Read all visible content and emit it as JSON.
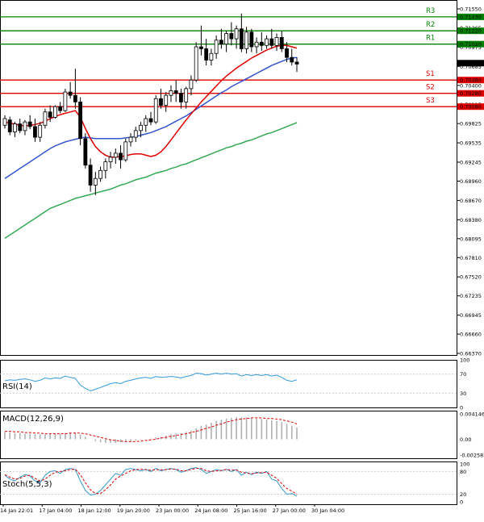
{
  "chart_data": {
    "type": "candlestick",
    "main": {
      "ylim": [
        0.6637,
        0.7155
      ],
      "y_ticks": [
        "0.71550",
        "0.71265",
        "0.70975",
        "0.70685",
        "0.70400",
        "0.70115",
        "0.69825",
        "0.69535",
        "0.69245",
        "0.68960",
        "0.68670",
        "0.68380",
        "0.68095",
        "0.67810",
        "0.67520",
        "0.67235",
        "0.66945",
        "0.66660",
        "0.66370"
      ],
      "current_price": "0.70734",
      "candles": [
        [
          0.698,
          0.6995,
          0.6975,
          0.699
        ],
        [
          0.6988,
          0.6993,
          0.6965,
          0.697
        ],
        [
          0.697,
          0.6985,
          0.6962,
          0.6982
        ],
        [
          0.6982,
          0.699,
          0.6968,
          0.6972
        ],
        [
          0.6972,
          0.6988,
          0.6965,
          0.6985
        ],
        [
          0.6985,
          0.6995,
          0.6974,
          0.6978
        ],
        [
          0.6978,
          0.699,
          0.6955,
          0.6962
        ],
        [
          0.6962,
          0.6985,
          0.6955,
          0.698
        ],
        [
          0.698,
          0.7005,
          0.6975,
          0.7
        ],
        [
          0.7,
          0.701,
          0.6985,
          0.6992
        ],
        [
          0.6992,
          0.701,
          0.699,
          0.7008
        ],
        [
          0.7008,
          0.7015,
          0.6998,
          0.7002
        ],
        [
          0.7002,
          0.7035,
          0.7,
          0.703
        ],
        [
          0.703,
          0.7045,
          0.702,
          0.7025
        ],
        [
          0.7025,
          0.7065,
          0.7005,
          0.7015
        ],
        [
          0.7015,
          0.7022,
          0.695,
          0.696
        ],
        [
          0.696,
          0.6968,
          0.6915,
          0.692
        ],
        [
          0.692,
          0.693,
          0.688,
          0.689
        ],
        [
          0.689,
          0.691,
          0.6875,
          0.69
        ],
        [
          0.69,
          0.6918,
          0.6895,
          0.6912
        ],
        [
          0.6912,
          0.693,
          0.69,
          0.6925
        ],
        [
          0.6925,
          0.694,
          0.6915,
          0.6932
        ],
        [
          0.6932,
          0.6945,
          0.6922,
          0.6938
        ],
        [
          0.6938,
          0.695,
          0.6915,
          0.6928
        ],
        [
          0.6928,
          0.696,
          0.6925,
          0.6955
        ],
        [
          0.6955,
          0.6968,
          0.6948,
          0.6962
        ],
        [
          0.6962,
          0.6978,
          0.6955,
          0.6972
        ],
        [
          0.6972,
          0.6985,
          0.6962,
          0.698
        ],
        [
          0.698,
          0.6995,
          0.697,
          0.699
        ],
        [
          0.699,
          0.7,
          0.698,
          0.6985
        ],
        [
          0.6985,
          0.7025,
          0.6982,
          0.702
        ],
        [
          0.702,
          0.7035,
          0.7005,
          0.701
        ],
        [
          0.701,
          0.703,
          0.7,
          0.7025
        ],
        [
          0.7025,
          0.704,
          0.7015,
          0.7032
        ],
        [
          0.7032,
          0.7048,
          0.7015,
          0.7028
        ],
        [
          0.7028,
          0.7035,
          0.7005,
          0.7015
        ],
        [
          0.7015,
          0.7038,
          0.7005,
          0.7035
        ],
        [
          0.7035,
          0.7055,
          0.7025,
          0.7048
        ],
        [
          0.7048,
          0.7105,
          0.7045,
          0.7098
        ],
        [
          0.7098,
          0.713,
          0.7085,
          0.7095
        ],
        [
          0.7095,
          0.711,
          0.707,
          0.7078
        ],
        [
          0.7078,
          0.7095,
          0.707,
          0.7088
        ],
        [
          0.7088,
          0.7115,
          0.708,
          0.7108
        ],
        [
          0.7108,
          0.7125,
          0.7095,
          0.7102
        ],
        [
          0.7102,
          0.7122,
          0.709,
          0.7118
        ],
        [
          0.7118,
          0.7135,
          0.71,
          0.711
        ],
        [
          0.711,
          0.713,
          0.7095,
          0.7125
        ],
        [
          0.7125,
          0.7148,
          0.709,
          0.7095
        ],
        [
          0.7095,
          0.7128,
          0.7088,
          0.712
        ],
        [
          0.712,
          0.7125,
          0.709,
          0.7098
        ],
        [
          0.7098,
          0.7112,
          0.7088,
          0.7105
        ],
        [
          0.7105,
          0.712,
          0.7092,
          0.71
        ],
        [
          0.71,
          0.7115,
          0.7095,
          0.711
        ],
        [
          0.711,
          0.7125,
          0.7095,
          0.71
        ],
        [
          0.71,
          0.7118,
          0.7092,
          0.7112
        ],
        [
          0.7112,
          0.7122,
          0.709,
          0.7095
        ],
        [
          0.7095,
          0.7105,
          0.7075,
          0.7082
        ],
        [
          0.7082,
          0.7095,
          0.707,
          0.7075
        ],
        [
          0.7075,
          0.7082,
          0.706,
          0.7072
        ]
      ],
      "ma_fast": [
        0.6985,
        0.6983,
        0.6982,
        0.698,
        0.6979,
        0.698,
        0.6981,
        0.6983,
        0.6986,
        0.699,
        0.6993,
        0.6996,
        0.6998,
        0.7,
        0.7002,
        0.6992,
        0.6975,
        0.696,
        0.6948,
        0.694,
        0.6935,
        0.6932,
        0.6932,
        0.6933,
        0.6934,
        0.6936,
        0.6937,
        0.6937,
        0.6935,
        0.6933,
        0.6935,
        0.694,
        0.6948,
        0.6958,
        0.6968,
        0.6978,
        0.6988,
        0.6997,
        0.7006,
        0.7015,
        0.7023,
        0.7031,
        0.7039,
        0.7047,
        0.7054,
        0.706,
        0.7066,
        0.7071,
        0.7076,
        0.7081,
        0.7085,
        0.7089,
        0.7093,
        0.7096,
        0.7099,
        0.71,
        0.71,
        0.7098,
        0.7096
      ],
      "ma_mid": [
        0.69,
        0.6905,
        0.691,
        0.6915,
        0.692,
        0.6925,
        0.693,
        0.6935,
        0.694,
        0.6945,
        0.6949,
        0.6952,
        0.6955,
        0.6957,
        0.6959,
        0.6961,
        0.6962,
        0.6961,
        0.696,
        0.696,
        0.696,
        0.696,
        0.696,
        0.696,
        0.6961,
        0.6962,
        0.6963,
        0.6965,
        0.6967,
        0.6969,
        0.6972,
        0.6975,
        0.6978,
        0.6982,
        0.6986,
        0.699,
        0.6994,
        0.6999,
        0.7004,
        0.7009,
        0.7014,
        0.7019,
        0.7024,
        0.7029,
        0.7033,
        0.7038,
        0.7042,
        0.7046,
        0.705,
        0.7054,
        0.7058,
        0.7062,
        0.7066,
        0.707,
        0.7073,
        0.7076,
        0.7079,
        0.7081,
        0.7082
      ],
      "ma_slow": [
        0.681,
        0.6815,
        0.682,
        0.6825,
        0.683,
        0.6835,
        0.684,
        0.6845,
        0.685,
        0.6855,
        0.6858,
        0.6861,
        0.6864,
        0.6867,
        0.687,
        0.6872,
        0.6874,
        0.6876,
        0.6878,
        0.688,
        0.6882,
        0.6884,
        0.6887,
        0.689,
        0.6892,
        0.6895,
        0.6898,
        0.69,
        0.6902,
        0.6905,
        0.6908,
        0.691,
        0.6912,
        0.6915,
        0.6917,
        0.692,
        0.6922,
        0.6925,
        0.6928,
        0.6931,
        0.6934,
        0.6937,
        0.694,
        0.6943,
        0.6946,
        0.6948,
        0.6951,
        0.6953,
        0.6956,
        0.6958,
        0.6961,
        0.6964,
        0.6967,
        0.6969,
        0.6972,
        0.6975,
        0.6978,
        0.6981,
        0.6984
      ],
      "levels": [
        {
          "label": "R3",
          "value": 0.7143,
          "value_text": "0.71430",
          "color": "#008000"
        },
        {
          "label": "R2",
          "value": 0.7122,
          "value_text": "0.71220",
          "color": "#008000"
        },
        {
          "label": "R1",
          "value": 0.7102,
          "value_text": "0.71020",
          "color": "#008000"
        },
        {
          "label": "S1",
          "value": 0.7048,
          "value_text": "0.70480",
          "color": "#e00000"
        },
        {
          "label": "S2",
          "value": 0.7028,
          "value_text": "0.70280",
          "color": "#e00000"
        },
        {
          "label": "S3",
          "value": 0.7008,
          "value_text": "0.70080",
          "color": "#e00000"
        }
      ]
    },
    "x_labels": [
      "14 Jan 22:01",
      "17 Jan 04:00",
      "18 Jan 12:00",
      "19 Jan 20:00",
      "23 Jan 00:00",
      "24 Jan 08:00",
      "25 Jan 16:00",
      "27 Jan 00:00",
      "30 Jan 04:00"
    ],
    "rsi": {
      "label": "RSI(14)",
      "ylim": [
        0,
        100
      ],
      "ticks": [
        "100",
        "70",
        "30",
        "0"
      ],
      "values": [
        56,
        58,
        57,
        59,
        60,
        58,
        55,
        57,
        62,
        60,
        62,
        61,
        66,
        63,
        61,
        47,
        40,
        35,
        38,
        42,
        46,
        50,
        52,
        50,
        55,
        57,
        60,
        62,
        63,
        61,
        65,
        63,
        64,
        65,
        64,
        62,
        65,
        67,
        72,
        71,
        68,
        70,
        72,
        70,
        72,
        70,
        71,
        66,
        69,
        67,
        69,
        67,
        69,
        66,
        68,
        63,
        57,
        55,
        58
      ]
    },
    "macd": {
      "label": "MACD(12,26,9)",
      "ticks": [
        "0.004146",
        "0.00",
        "-0.002585"
      ],
      "ylim": [
        -0.002585,
        0.004146
      ],
      "histogram": [
        0.0012,
        0.0011,
        0.001,
        0.001,
        0.0009,
        0.0009,
        0.0008,
        0.0008,
        0.0008,
        0.0009,
        0.0009,
        0.0009,
        0.001,
        0.0011,
        0.0011,
        0.0008,
        0.0004,
        0.0,
        -0.0003,
        -0.0005,
        -0.0006,
        -0.0006,
        -0.0006,
        -0.0005,
        -0.0004,
        -0.0003,
        -0.0002,
        -0.0001,
        0.0,
        0.0001,
        0.0003,
        0.0004,
        0.0006,
        0.0008,
        0.0009,
        0.001,
        0.0012,
        0.0014,
        0.0018,
        0.0022,
        0.0024,
        0.0027,
        0.003,
        0.0032,
        0.0034,
        0.0035,
        0.0036,
        0.0036,
        0.0036,
        0.0035,
        0.0034,
        0.0033,
        0.0032,
        0.0031,
        0.003,
        0.0028,
        0.0025,
        0.0022,
        0.0019
      ],
      "signal": [
        0.0013,
        0.0013,
        0.0012,
        0.0012,
        0.0011,
        0.0011,
        0.001,
        0.001,
        0.0009,
        0.0009,
        0.0009,
        0.0009,
        0.0009,
        0.001,
        0.001,
        0.001,
        0.0009,
        0.0007,
        0.0005,
        0.0003,
        0.0001,
        -0.0001,
        -0.0002,
        -0.0003,
        -0.0004,
        -0.0004,
        -0.0004,
        -0.0003,
        -0.0002,
        -0.0001,
        0.0,
        0.0002,
        0.0003,
        0.0005,
        0.0006,
        0.0008,
        0.0009,
        0.0011,
        0.0013,
        0.0015,
        0.0018,
        0.002,
        0.0023,
        0.0025,
        0.0028,
        0.003,
        0.0032,
        0.0033,
        0.0034,
        0.0035,
        0.0035,
        0.0035,
        0.0034,
        0.0034,
        0.0033,
        0.0032,
        0.003,
        0.0028,
        0.0025
      ]
    },
    "stoch": {
      "label": "Stoch(5,5,3)",
      "ylim": [
        0,
        100
      ],
      "ticks": [
        "100",
        "80",
        "20",
        "0"
      ],
      "k": [
        70,
        60,
        55,
        65,
        72,
        68,
        55,
        50,
        70,
        80,
        82,
        75,
        85,
        88,
        85,
        55,
        30,
        18,
        20,
        30,
        45,
        60,
        75,
        70,
        85,
        88,
        85,
        82,
        85,
        80,
        88,
        82,
        85,
        88,
        85,
        78,
        82,
        88,
        90,
        85,
        75,
        80,
        85,
        82,
        86,
        80,
        85,
        70,
        78,
        72,
        78,
        75,
        80,
        60,
        55,
        35,
        20,
        22,
        15
      ],
      "d": [
        72,
        65,
        60,
        62,
        68,
        70,
        62,
        55,
        60,
        70,
        78,
        80,
        82,
        85,
        86,
        72,
        50,
        32,
        22,
        22,
        32,
        45,
        60,
        68,
        75,
        82,
        85,
        86,
        85,
        83,
        85,
        84,
        85,
        86,
        86,
        82,
        82,
        85,
        88,
        88,
        82,
        80,
        82,
        83,
        85,
        84,
        84,
        78,
        76,
        74,
        76,
        77,
        78,
        70,
        62,
        48,
        35,
        28,
        20
      ]
    },
    "colors": {
      "bull": "#008000",
      "bear": "#e00000",
      "ma_fast": "#e00000",
      "ma_mid": "#3355cc",
      "ma_slow": "#33aa55",
      "rsi_line": "#3399dd",
      "macd_hist": "#b0b0b0",
      "macd_signal": "#e00000",
      "stoch_k": "#3399cc",
      "stoch_d": "#e00000",
      "current_price_bg": "#000000"
    }
  }
}
